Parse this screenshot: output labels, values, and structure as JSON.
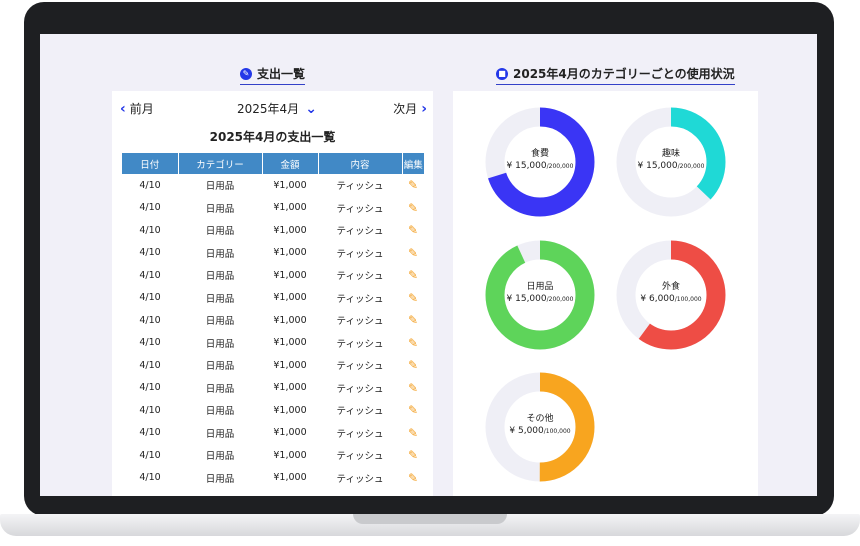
{
  "left_section": {
    "title": "支出一覧"
  },
  "right_section": {
    "title": "2025年4月のカテゴリーごとの使用状況"
  },
  "nav": {
    "prev": "前月",
    "month": "2025年4月",
    "next": "次月"
  },
  "list_title": "2025年4月の支出一覧",
  "table": {
    "headers": [
      "日付",
      "カテゴリー",
      "金額",
      "内容",
      "編集"
    ],
    "rows": [
      [
        "4/10",
        "日用品",
        "¥1,000",
        "ティッシュ"
      ],
      [
        "4/10",
        "日用品",
        "¥1,000",
        "ティッシュ"
      ],
      [
        "4/10",
        "日用品",
        "¥1,000",
        "ティッシュ"
      ],
      [
        "4/10",
        "日用品",
        "¥1,000",
        "ティッシュ"
      ],
      [
        "4/10",
        "日用品",
        "¥1,000",
        "ティッシュ"
      ],
      [
        "4/10",
        "日用品",
        "¥1,000",
        "ティッシュ"
      ],
      [
        "4/10",
        "日用品",
        "¥1,000",
        "ティッシュ"
      ],
      [
        "4/10",
        "日用品",
        "¥1,000",
        "ティッシュ"
      ],
      [
        "4/10",
        "日用品",
        "¥1,000",
        "ティッシュ"
      ],
      [
        "4/10",
        "日用品",
        "¥1,000",
        "ティッシュ"
      ],
      [
        "4/10",
        "日用品",
        "¥1,000",
        "ティッシュ"
      ],
      [
        "4/10",
        "日用品",
        "¥1,000",
        "ティッシュ"
      ],
      [
        "4/10",
        "日用品",
        "¥1,000",
        "ティッシュ"
      ],
      [
        "4/10",
        "日用品",
        "¥1,000",
        "ティッシュ"
      ]
    ]
  },
  "icons": {
    "left_title": "pencil-circle-icon",
    "right_title": "bag-circle-icon",
    "edit": "pencil-icon",
    "prev": "chevron-left-icon",
    "next": "chevron-right-icon",
    "month": "chevron-down-icon"
  },
  "categories": [
    {
      "name": "食費",
      "amount": "¥ 15,000",
      "max": "/200,000",
      "fraction": 0.7,
      "color": "#3a35f5"
    },
    {
      "name": "趣味",
      "amount": "¥ 15,000",
      "max": "/200,000",
      "fraction": 0.37,
      "color": "#1fd9d6"
    },
    {
      "name": "日用品",
      "amount": "¥ 15,000",
      "max": "/200,000",
      "fraction": 0.93,
      "color": "#5ed45a"
    },
    {
      "name": "外食",
      "amount": "¥ 6,000",
      "max": "/100,000",
      "fraction": 0.6,
      "color": "#ee4d45"
    },
    {
      "name": "その他",
      "amount": "¥ 5,000",
      "max": "/100,000",
      "fraction": 0.5,
      "color": "#f8a51f"
    }
  ],
  "colors": {
    "track": "#efeff6",
    "header": "#4189c6",
    "accent": "#2438e8"
  }
}
